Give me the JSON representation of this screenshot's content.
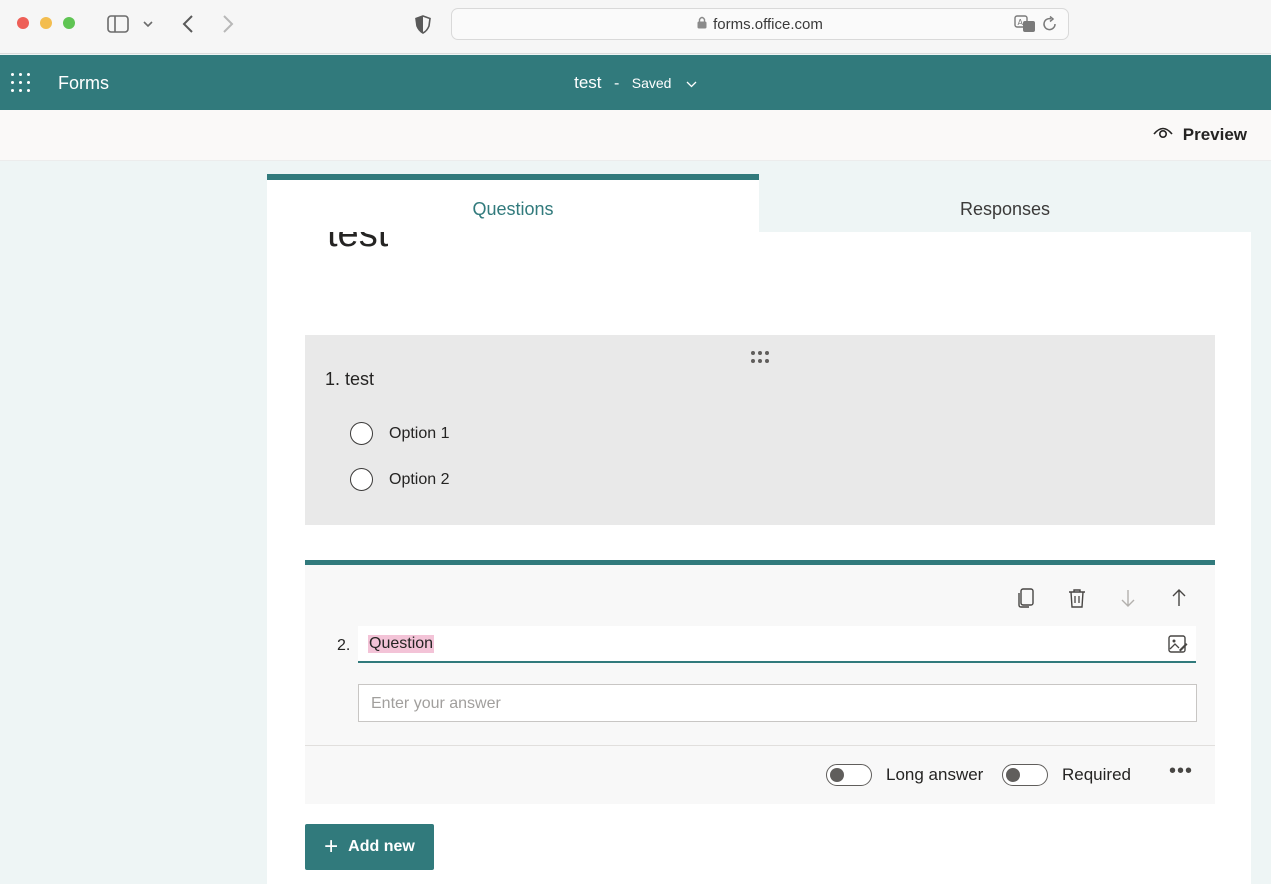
{
  "browser": {
    "url": "forms.office.com"
  },
  "header": {
    "app_name": "Forms",
    "form_title": "test",
    "separator": "-",
    "save_status": "Saved"
  },
  "toolbar": {
    "preview_label": "Preview"
  },
  "tabs": [
    {
      "label": "Questions",
      "active": true
    },
    {
      "label": "Responses",
      "active": false
    }
  ],
  "form": {
    "title": "test"
  },
  "questions": [
    {
      "number": "1.",
      "title": "test",
      "options": [
        "Option 1",
        "Option 2"
      ]
    },
    {
      "number": "2.",
      "title_value": "Question",
      "answer_placeholder": "Enter your answer",
      "long_answer_label": "Long answer",
      "required_label": "Required"
    }
  ],
  "add_new_label": "Add new",
  "colors": {
    "brand": "#317a7c",
    "background": "#eef5f5"
  }
}
